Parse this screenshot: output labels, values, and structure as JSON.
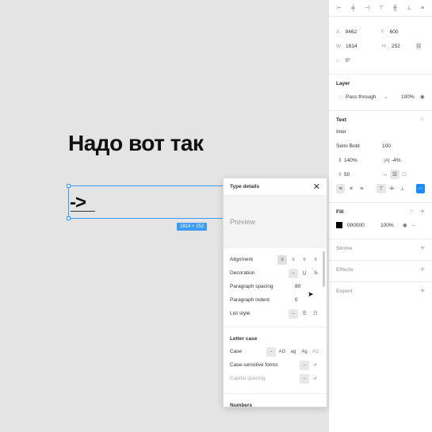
{
  "canvas": {
    "headline": "Надо вот так",
    "arrow_text": "->",
    "size_badge": "1814 × 252"
  },
  "panel": {
    "position": {
      "x_label": "X",
      "x_value": "9462",
      "y_label": "Y",
      "y_value": "600"
    },
    "size": {
      "w_label": "W",
      "w_value": "1814",
      "h_label": "H",
      "h_value": "252"
    },
    "rotation": "0°",
    "layer": {
      "title": "Layer",
      "blend": "Pass through",
      "opacity": "100%"
    },
    "text": {
      "title": "Text",
      "font": "Inter",
      "weight": "Semi Bold",
      "size": "100",
      "line_height": "140%",
      "letter_spacing": "-4%",
      "paragraph": "50"
    },
    "fill": {
      "title": "Fill",
      "hex": "000000",
      "opacity": "100%",
      "color": "#000000"
    },
    "stroke": {
      "title": "Stroke"
    },
    "effects": {
      "title": "Effects"
    },
    "export": {
      "title": "Export"
    }
  },
  "popup": {
    "title": "Type details",
    "preview": "Preview",
    "rows": {
      "alignment": "Alignment",
      "decoration": "Decoration",
      "paragraph_spacing": "Paragraph spacing",
      "paragraph_spacing_value": "80",
      "paragraph_indent": "Paragraph indent",
      "paragraph_indent_value": "0",
      "list_style": "List style"
    },
    "letter_case": {
      "title": "Letter case",
      "case": "Case",
      "options": [
        "-",
        "AG",
        "ag",
        "Ag",
        "AG"
      ],
      "case_sensitive": "Case-sensitive forms",
      "capital_spacing": "Capital spacing"
    },
    "numbers_title": "Numbers"
  },
  "colors": {
    "accent": "#1a8cff",
    "selection": "#3a9cf5"
  }
}
